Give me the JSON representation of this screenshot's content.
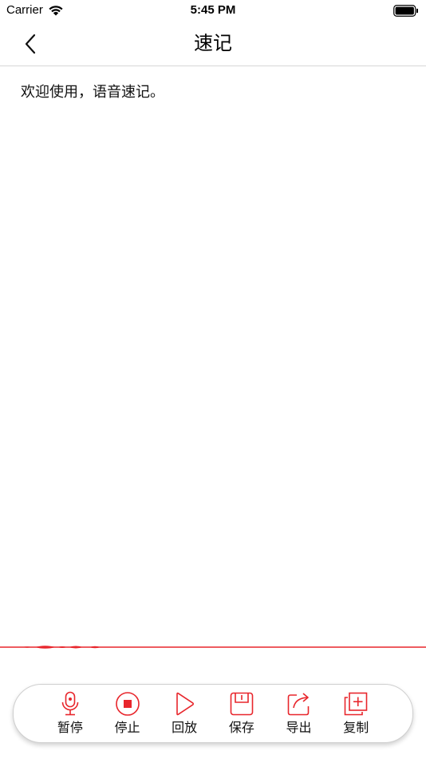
{
  "status_bar": {
    "carrier": "Carrier",
    "time": "5:45 PM",
    "wifi_icon": "wifi-icon",
    "battery_icon": "battery-full-icon"
  },
  "nav": {
    "title": "速记",
    "back_icon": "chevron-left-icon"
  },
  "content": {
    "text": "欢迎使用，语音速记。"
  },
  "toolbar": {
    "buttons": [
      {
        "label": "暂停",
        "icon": "microphone-icon"
      },
      {
        "label": "停止",
        "icon": "stop-icon"
      },
      {
        "label": "回放",
        "icon": "play-icon"
      },
      {
        "label": "保存",
        "icon": "save-icon"
      },
      {
        "label": "导出",
        "icon": "export-icon"
      },
      {
        "label": "复制",
        "icon": "copy-icon"
      }
    ]
  },
  "colors": {
    "accent": "#e8262c",
    "divider": "#d6d6d6",
    "text": "#111111"
  }
}
